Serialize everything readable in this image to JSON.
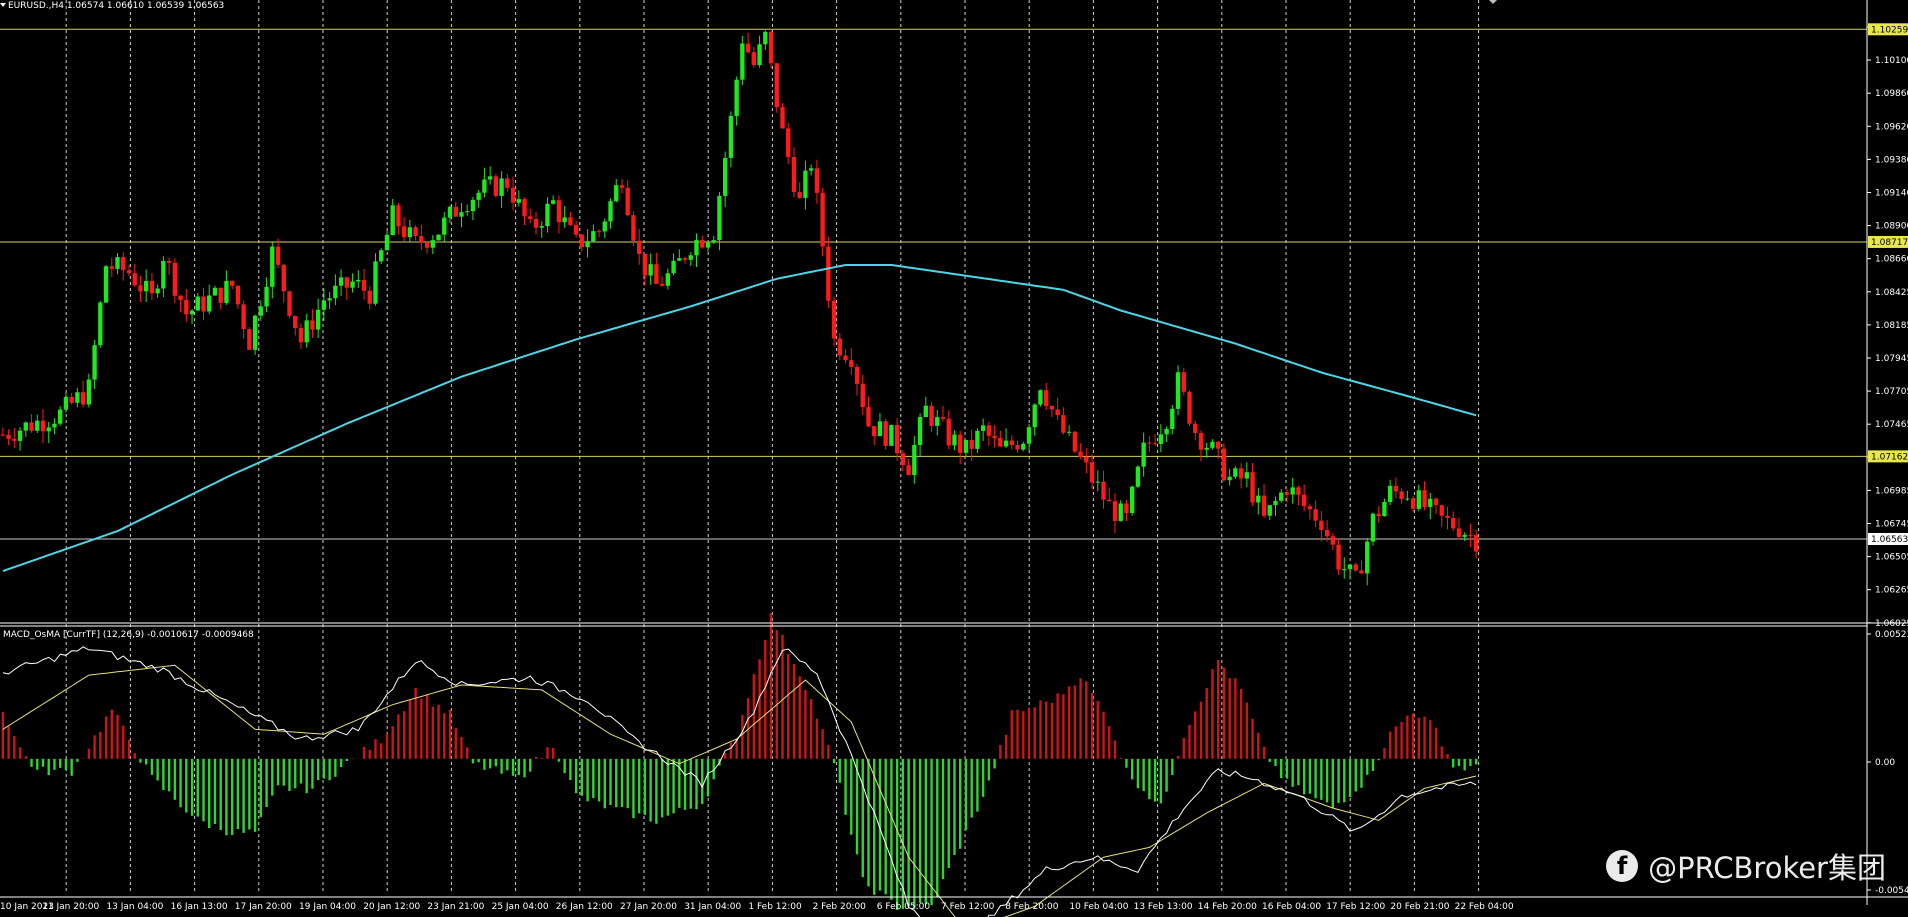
{
  "header": {
    "title": "EURUSD.,H4  1.06574 1.06610 1.06539 1.06563"
  },
  "colors": {
    "background": "#000000",
    "bull_candle": "#1ee81e",
    "bear_candle": "#ff1a1a",
    "moving_average": "#4fd4e6",
    "horizontal_line": "#d4cf6a",
    "price_line": "#c9c9c9",
    "macd_main": "#ffffff",
    "macd_signal": "#e6e07a",
    "osma_up": "#d01414",
    "osma_down": "#2ed62e"
  },
  "price_axis": {
    "ticks": [
      "1.10340",
      "1.10100",
      "1.09860",
      "1.09620",
      "1.09380",
      "1.09140",
      "1.08900",
      "1.08660",
      "1.08425",
      "1.08185",
      "1.07945",
      "1.07705",
      "1.07465",
      "1.07225",
      "1.06985",
      "1.06745",
      "1.06505",
      "1.06265",
      "1.06025"
    ],
    "levels": [
      {
        "value": 1.10259,
        "label": "1.10259"
      },
      {
        "value": 1.08717,
        "label": "1.08717"
      },
      {
        "value": 1.07162,
        "label": "1.07162"
      }
    ],
    "current_price": {
      "value": 1.06563,
      "label": "1.06563"
    }
  },
  "indicator": {
    "title": "MACD_OsMA [CurrTF] (12,26,9) -0.0010617 -0.0009468",
    "ticks": [
      "0.005234",
      "0.00",
      "-0.005413"
    ]
  },
  "time_axis": {
    "labels": [
      "10 Jan 2023",
      "11 Jan 20:00",
      "13 Jan 04:00",
      "16 Jan 13:00",
      "17 Jan 20:00",
      "19 Jan 04:00",
      "20 Jan 12:00",
      "23 Jan 21:00",
      "25 Jan 04:00",
      "26 Jan 12:00",
      "27 Jan 20:00",
      "31 Jan 04:00",
      "1 Feb 12:00",
      "2 Feb 20:00",
      "6 Feb 05:00",
      "7 Feb 12:00",
      "8 Feb 20:00",
      "10 Feb 04:00",
      "13 Feb 13:00",
      "14 Feb 20:00",
      "16 Feb 04:00",
      "17 Feb 12:00",
      "20 Feb 21:00",
      "22 Feb 04:00"
    ]
  },
  "watermark": {
    "icon": "facebook-icon",
    "text": "@PRCBroker集团"
  },
  "chart_data": {
    "type": "candlestick",
    "symbol": "EURUSD.",
    "timeframe": "H4",
    "y_range": [
      1.0599,
      1.1037
    ],
    "waypoints": [
      {
        "x": 0,
        "close": 1.0732
      },
      {
        "x": 10,
        "close": 1.0747
      },
      {
        "x": 15,
        "close": 1.0765
      },
      {
        "x": 18,
        "close": 1.0855
      },
      {
        "x": 22,
        "close": 1.085
      },
      {
        "x": 26,
        "close": 1.083
      },
      {
        "x": 28,
        "close": 1.0863
      },
      {
        "x": 32,
        "close": 1.082
      },
      {
        "x": 36,
        "close": 1.083
      },
      {
        "x": 40,
        "close": 1.084
      },
      {
        "x": 43,
        "close": 1.08
      },
      {
        "x": 47,
        "close": 1.0864
      },
      {
        "x": 52,
        "close": 1.08
      },
      {
        "x": 56,
        "close": 1.083
      },
      {
        "x": 61,
        "close": 1.0842
      },
      {
        "x": 64,
        "close": 1.0835
      },
      {
        "x": 68,
        "close": 1.089
      },
      {
        "x": 72,
        "close": 1.087
      },
      {
        "x": 76,
        "close": 1.088
      },
      {
        "x": 80,
        "close": 1.09
      },
      {
        "x": 84,
        "close": 1.091
      },
      {
        "x": 88,
        "close": 1.0915
      },
      {
        "x": 92,
        "close": 1.088
      },
      {
        "x": 96,
        "close": 1.09
      },
      {
        "x": 100,
        "close": 1.087
      },
      {
        "x": 104,
        "close": 1.088
      },
      {
        "x": 108,
        "close": 1.092
      },
      {
        "x": 111,
        "close": 1.086
      },
      {
        "x": 114,
        "close": 1.084
      },
      {
        "x": 117,
        "close": 1.085
      },
      {
        "x": 120,
        "close": 1.087
      },
      {
        "x": 124,
        "close": 1.088
      },
      {
        "x": 127,
        "close": 1.096
      },
      {
        "x": 129,
        "close": 1.102
      },
      {
        "x": 131,
        "close": 1.1
      },
      {
        "x": 133,
        "close": 1.102
      },
      {
        "x": 136,
        "close": 1.095
      },
      {
        "x": 139,
        "close": 1.09
      },
      {
        "x": 141,
        "close": 1.093
      },
      {
        "x": 143,
        "close": 1.087
      },
      {
        "x": 145,
        "close": 1.08
      },
      {
        "x": 148,
        "close": 1.079
      },
      {
        "x": 151,
        "close": 1.074
      },
      {
        "x": 155,
        "close": 1.073
      },
      {
        "x": 158,
        "close": 1.071
      },
      {
        "x": 161,
        "close": 1.075
      },
      {
        "x": 165,
        "close": 1.073
      },
      {
        "x": 168,
        "close": 1.072
      },
      {
        "x": 171,
        "close": 1.0735
      },
      {
        "x": 174,
        "close": 1.072
      },
      {
        "x": 178,
        "close": 1.073
      },
      {
        "x": 181,
        "close": 1.077
      },
      {
        "x": 184,
        "close": 1.074
      },
      {
        "x": 187,
        "close": 1.072
      },
      {
        "x": 190,
        "close": 1.07
      },
      {
        "x": 193,
        "close": 1.068
      },
      {
        "x": 196,
        "close": 1.067
      },
      {
        "x": 199,
        "close": 1.072
      },
      {
        "x": 203,
        "close": 1.0745
      },
      {
        "x": 205,
        "close": 1.077
      },
      {
        "x": 208,
        "close": 1.0735
      },
      {
        "x": 211,
        "close": 1.072
      },
      {
        "x": 214,
        "close": 1.07
      },
      {
        "x": 217,
        "close": 1.07
      },
      {
        "x": 220,
        "close": 1.067
      },
      {
        "x": 224,
        "close": 1.0695
      },
      {
        "x": 227,
        "close": 1.068
      },
      {
        "x": 230,
        "close": 1.067
      },
      {
        "x": 233,
        "close": 1.064
      },
      {
        "x": 236,
        "close": 1.0625
      },
      {
        "x": 239,
        "close": 1.067
      },
      {
        "x": 242,
        "close": 1.069
      },
      {
        "x": 245,
        "close": 1.069
      },
      {
        "x": 248,
        "close": 1.068
      },
      {
        "x": 251,
        "close": 1.067
      },
      {
        "x": 254,
        "close": 1.0665
      },
      {
        "x": 257,
        "close": 1.0656
      }
    ],
    "moving_average": [
      {
        "x": 0,
        "value": 1.0633
      },
      {
        "x": 20,
        "value": 1.0662
      },
      {
        "x": 40,
        "value": 1.0703
      },
      {
        "x": 60,
        "value": 1.074
      },
      {
        "x": 80,
        "value": 1.0774
      },
      {
        "x": 100,
        "value": 1.0801
      },
      {
        "x": 120,
        "value": 1.0825
      },
      {
        "x": 135,
        "value": 1.0845
      },
      {
        "x": 147,
        "value": 1.0855
      },
      {
        "x": 155,
        "value": 1.0855
      },
      {
        "x": 170,
        "value": 1.0846
      },
      {
        "x": 185,
        "value": 1.0837
      },
      {
        "x": 195,
        "value": 1.0822
      },
      {
        "x": 205,
        "value": 1.081
      },
      {
        "x": 215,
        "value": 1.0798
      },
      {
        "x": 230,
        "value": 1.0777
      },
      {
        "x": 245,
        "value": 1.076
      },
      {
        "x": 257,
        "value": 1.0746
      }
    ],
    "macd_y_range": [
      -0.005413,
      0.005234
    ],
    "osma_waypoints": [
      {
        "x": 0,
        "value": 0.002
      },
      {
        "x": 3,
        "value": 0.0004
      },
      {
        "x": 6,
        "value": -0.0005
      },
      {
        "x": 12,
        "value": -0.0005
      },
      {
        "x": 15,
        "value": 0.0005
      },
      {
        "x": 19,
        "value": 0.002
      },
      {
        "x": 22,
        "value": 0.0008
      },
      {
        "x": 26,
        "value": -0.0008
      },
      {
        "x": 34,
        "value": -0.0025
      },
      {
        "x": 40,
        "value": -0.003
      },
      {
        "x": 44,
        "value": -0.003
      },
      {
        "x": 48,
        "value": -0.0012
      },
      {
        "x": 54,
        "value": -0.0012
      },
      {
        "x": 60,
        "value": -0.0002
      },
      {
        "x": 66,
        "value": 0.0008
      },
      {
        "x": 72,
        "value": 0.0028
      },
      {
        "x": 78,
        "value": 0.0018
      },
      {
        "x": 82,
        "value": -0.0002
      },
      {
        "x": 90,
        "value": -0.0008
      },
      {
        "x": 96,
        "value": 0.0006
      },
      {
        "x": 100,
        "value": -0.0015
      },
      {
        "x": 106,
        "value": -0.002
      },
      {
        "x": 114,
        "value": -0.0025
      },
      {
        "x": 122,
        "value": -0.0018
      },
      {
        "x": 128,
        "value": 0.001
      },
      {
        "x": 134,
        "value": 0.0058
      },
      {
        "x": 140,
        "value": 0.003
      },
      {
        "x": 145,
        "value": -0.0002
      },
      {
        "x": 150,
        "value": -0.005
      },
      {
        "x": 156,
        "value": -0.006
      },
      {
        "x": 162,
        "value": -0.006
      },
      {
        "x": 168,
        "value": -0.003
      },
      {
        "x": 172,
        "value": -0.001
      },
      {
        "x": 176,
        "value": 0.0018
      },
      {
        "x": 184,
        "value": 0.0025
      },
      {
        "x": 188,
        "value": 0.0034
      },
      {
        "x": 193,
        "value": 0.0015
      },
      {
        "x": 196,
        "value": -0.0005
      },
      {
        "x": 202,
        "value": -0.002
      },
      {
        "x": 206,
        "value": 0.001
      },
      {
        "x": 212,
        "value": 0.004
      },
      {
        "x": 216,
        "value": 0.0028
      },
      {
        "x": 220,
        "value": 0.0003
      },
      {
        "x": 224,
        "value": -0.001
      },
      {
        "x": 232,
        "value": -0.002
      },
      {
        "x": 238,
        "value": -0.0008
      },
      {
        "x": 242,
        "value": 0.001
      },
      {
        "x": 246,
        "value": 0.002
      },
      {
        "x": 250,
        "value": 0.0012
      },
      {
        "x": 253,
        "value": -0.0003
      },
      {
        "x": 257,
        "value": -0.0004
      }
    ],
    "macd_main": [
      {
        "x": 0,
        "value": 0.0035
      },
      {
        "x": 15,
        "value": 0.0045
      },
      {
        "x": 28,
        "value": 0.0036
      },
      {
        "x": 40,
        "value": 0.0022
      },
      {
        "x": 52,
        "value": 0.0008
      },
      {
        "x": 62,
        "value": 0.0012
      },
      {
        "x": 72,
        "value": 0.004
      },
      {
        "x": 80,
        "value": 0.003
      },
      {
        "x": 92,
        "value": 0.0033
      },
      {
        "x": 102,
        "value": 0.0024
      },
      {
        "x": 110,
        "value": 0.0008
      },
      {
        "x": 122,
        "value": -0.001
      },
      {
        "x": 130,
        "value": 0.0015
      },
      {
        "x": 136,
        "value": 0.0045
      },
      {
        "x": 142,
        "value": 0.0035
      },
      {
        "x": 150,
        "value": -0.001
      },
      {
        "x": 158,
        "value": -0.006
      },
      {
        "x": 165,
        "value": -0.0075
      },
      {
        "x": 172,
        "value": -0.0065
      },
      {
        "x": 182,
        "value": -0.0045
      },
      {
        "x": 190,
        "value": -0.004
      },
      {
        "x": 198,
        "value": -0.0045
      },
      {
        "x": 206,
        "value": -0.002
      },
      {
        "x": 212,
        "value": -0.0005
      },
      {
        "x": 218,
        "value": -0.0008
      },
      {
        "x": 226,
        "value": -0.0015
      },
      {
        "x": 236,
        "value": -0.003
      },
      {
        "x": 244,
        "value": -0.0015
      },
      {
        "x": 250,
        "value": -0.0012
      },
      {
        "x": 257,
        "value": -0.001
      }
    ],
    "macd_signal": [
      {
        "x": 0,
        "value": 0.0012
      },
      {
        "x": 15,
        "value": 0.0034
      },
      {
        "x": 30,
        "value": 0.0038
      },
      {
        "x": 44,
        "value": 0.0012
      },
      {
        "x": 56,
        "value": 0.001
      },
      {
        "x": 68,
        "value": 0.0022
      },
      {
        "x": 80,
        "value": 0.003
      },
      {
        "x": 94,
        "value": 0.0028
      },
      {
        "x": 106,
        "value": 0.001
      },
      {
        "x": 118,
        "value": -0.0002
      },
      {
        "x": 128,
        "value": 0.0008
      },
      {
        "x": 140,
        "value": 0.0032
      },
      {
        "x": 148,
        "value": 0.0015
      },
      {
        "x": 158,
        "value": -0.004
      },
      {
        "x": 168,
        "value": -0.007
      },
      {
        "x": 180,
        "value": -0.006
      },
      {
        "x": 192,
        "value": -0.004
      },
      {
        "x": 200,
        "value": -0.0036
      },
      {
        "x": 210,
        "value": -0.0022
      },
      {
        "x": 220,
        "value": -0.001
      },
      {
        "x": 232,
        "value": -0.002
      },
      {
        "x": 240,
        "value": -0.0025
      },
      {
        "x": 248,
        "value": -0.0012
      },
      {
        "x": 257,
        "value": -0.0007
      }
    ]
  }
}
